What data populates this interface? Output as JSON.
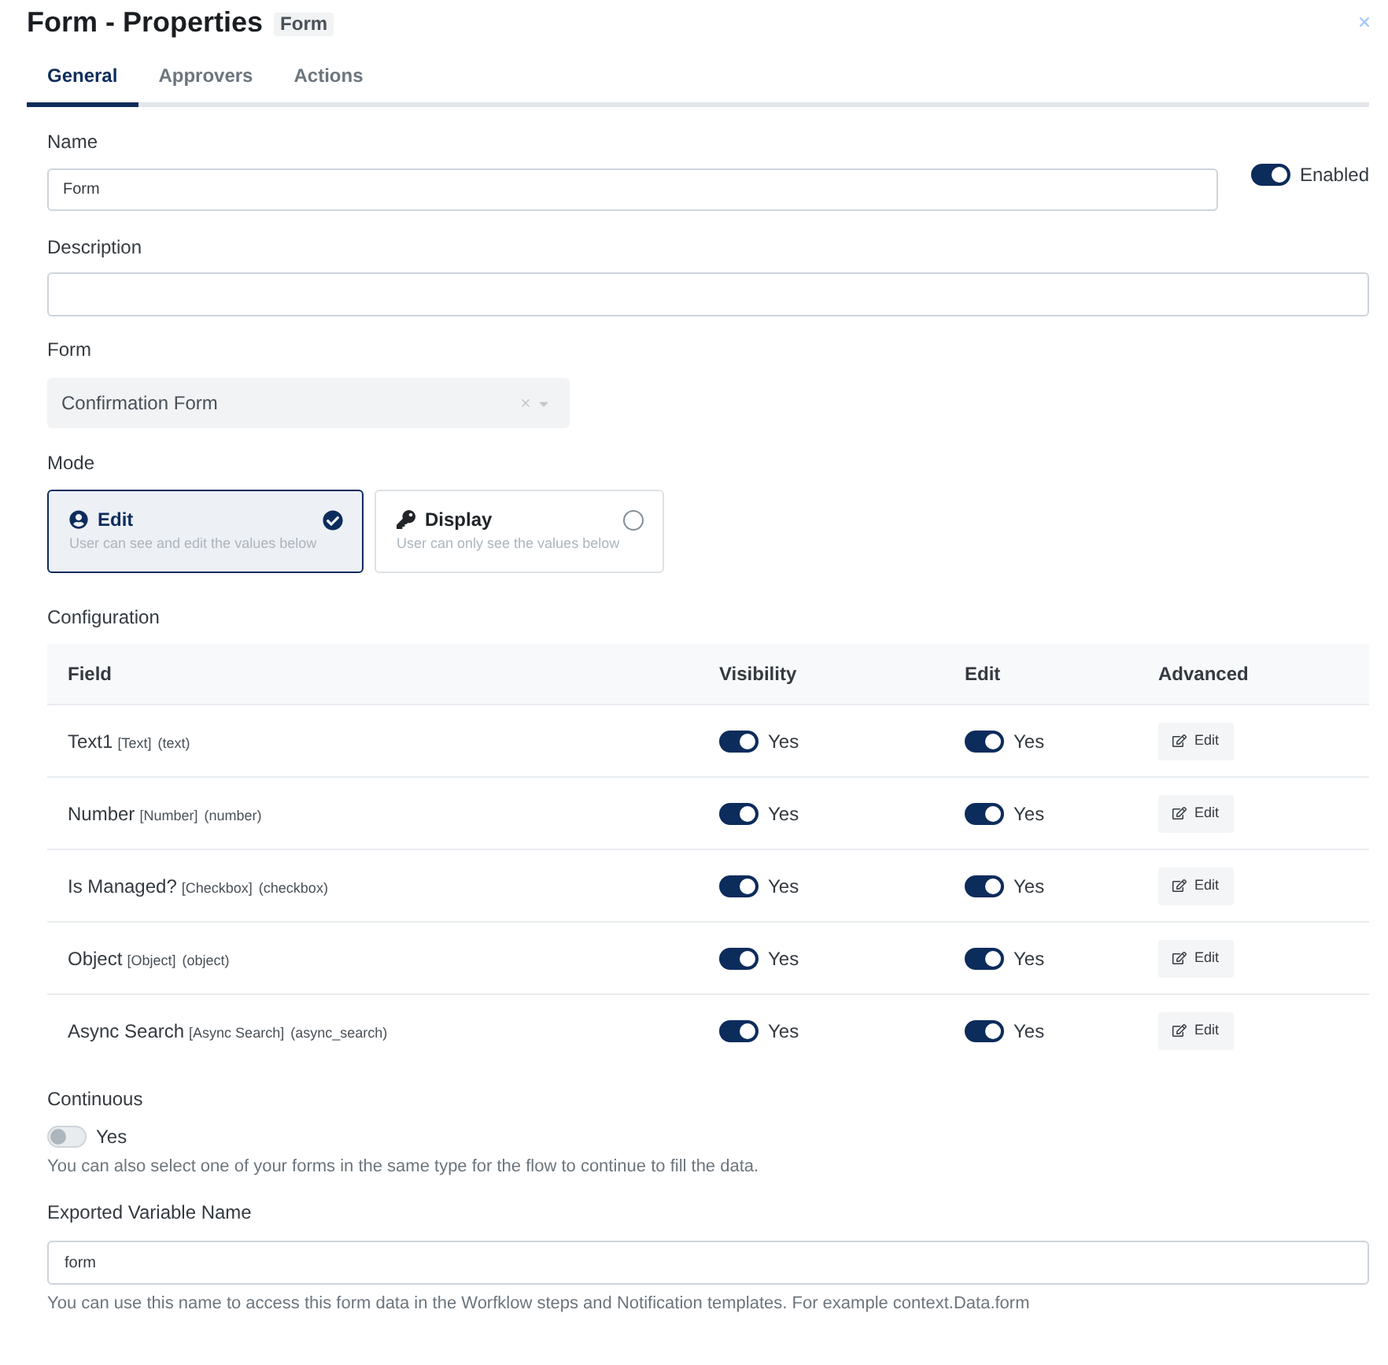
{
  "window": {
    "title": "Form - Properties",
    "badge": "Form"
  },
  "tabs": [
    {
      "label": "General",
      "selected": true
    },
    {
      "label": "Approvers",
      "selected": false
    },
    {
      "label": "Actions",
      "selected": false
    }
  ],
  "name": {
    "label": "Name",
    "value": "Form"
  },
  "enabled": {
    "label": "Enabled",
    "on": true
  },
  "description": {
    "label": "Description"
  },
  "form": {
    "label": "Form",
    "value": "Confirmation Form"
  },
  "mode": {
    "label": "Mode",
    "options": [
      {
        "kind": "edit",
        "title": "Edit",
        "description": "User can see and edit the values below",
        "selected": true
      },
      {
        "kind": "display",
        "title": "Display",
        "description": "User can only see the values below",
        "selected": false
      }
    ]
  },
  "configuration": {
    "label": "Configuration",
    "columns": [
      "Field",
      "Visibility",
      "Edit",
      "Advanced"
    ],
    "rows": [
      {
        "name": "Text1",
        "type": "[Text]",
        "key": "(text)",
        "visibility": {
          "on": true,
          "label": "Yes"
        },
        "edit": {
          "on": true,
          "label": "Yes"
        },
        "action": "Edit"
      },
      {
        "name": "Number",
        "type": "[Number]",
        "key": "(number)",
        "visibility": {
          "on": true,
          "label": "Yes"
        },
        "edit": {
          "on": true,
          "label": "Yes"
        },
        "action": "Edit"
      },
      {
        "name": "Is Managed?",
        "type": "[Checkbox]",
        "key": "(checkbox)",
        "visibility": {
          "on": true,
          "label": "Yes"
        },
        "edit": {
          "on": true,
          "label": "Yes"
        },
        "action": "Edit"
      },
      {
        "name": "Object",
        "type": "[Object]",
        "key": "(object)",
        "visibility": {
          "on": true,
          "label": "Yes"
        },
        "edit": {
          "on": true,
          "label": "Yes"
        },
        "action": "Edit"
      },
      {
        "name": "Async Search",
        "type": "[Async Search]",
        "key": "(async_search)",
        "visibility": {
          "on": true,
          "label": "Yes"
        },
        "edit": {
          "on": true,
          "label": "Yes"
        },
        "action": "Edit"
      }
    ]
  },
  "continuous": {
    "label": "Continuous",
    "on": false,
    "toggle_label": "Yes",
    "help": "You can also select one of your forms in the same type for the flow to continue to fill the data."
  },
  "exported_variable": {
    "label": "Exported Variable Name",
    "value": "form",
    "help": "You can use this name to access this form data in the Worfklow steps and Notification templates. For example context.Data.form"
  }
}
